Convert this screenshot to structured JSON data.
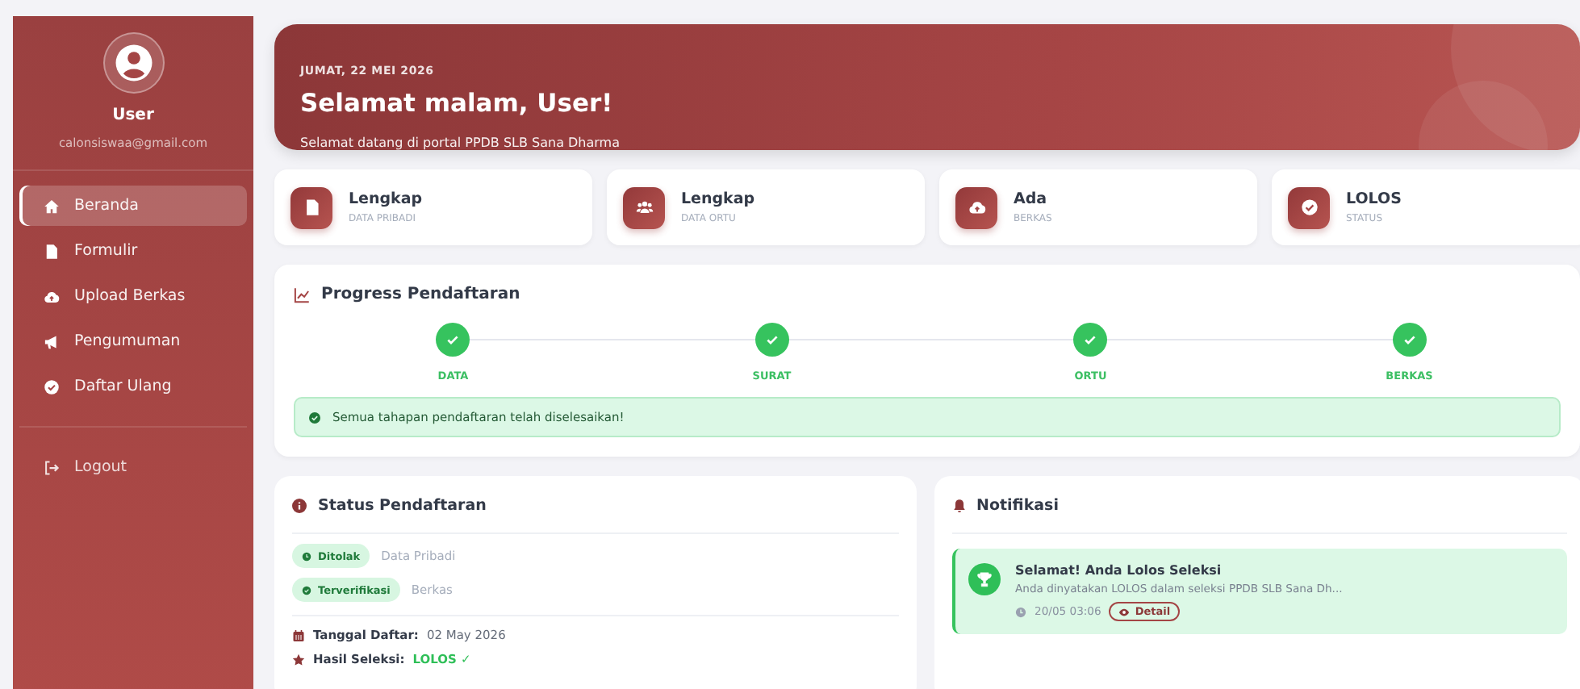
{
  "sidebar": {
    "user": {
      "name": "User",
      "email": "calonsiswaa@gmail.com"
    },
    "nav": [
      {
        "label": "Beranda",
        "selected": true
      },
      {
        "label": "Formulir",
        "selected": false
      },
      {
        "label": "Upload Berkas",
        "selected": false
      },
      {
        "label": "Pengumuman",
        "selected": false
      },
      {
        "label": "Daftar Ulang",
        "selected": false
      }
    ],
    "logout": {
      "label": "Logout"
    }
  },
  "hero": {
    "date": "JUMAT, 22 MEI 2026",
    "title": "Selamat malam, User!",
    "subtitle": "Selamat datang di portal PPDB SLB Sana Dharma"
  },
  "stats": [
    {
      "value": "Lengkap",
      "label": "DATA PRIBADI"
    },
    {
      "value": "Lengkap",
      "label": "DATA ORTU"
    },
    {
      "value": "Ada",
      "label": "BERKAS"
    },
    {
      "value": "LOLOS",
      "label": "STATUS"
    }
  ],
  "progress": {
    "title": "Progress Pendaftaran",
    "steps": [
      {
        "label": "DATA",
        "done": true
      },
      {
        "label": "SURAT",
        "done": true
      },
      {
        "label": "ORTU",
        "done": true
      },
      {
        "label": "BERKAS",
        "done": true
      }
    ],
    "message": "Semua tahapan pendaftaran telah diselesaikan!"
  },
  "status": {
    "title": "Status Pendaftaran",
    "badges": [
      {
        "badge": "Ditolak",
        "text": "Data Pribadi"
      },
      {
        "badge": "Terverifikasi",
        "text": "Berkas"
      }
    ],
    "details": [
      {
        "label": "Tanggal Daftar:",
        "value": "02 May 2026",
        "kind": "plain"
      },
      {
        "label": "Hasil Seleksi:",
        "value": "LOLOS ✓",
        "kind": "success"
      }
    ]
  },
  "notifications": {
    "title": "Notifikasi",
    "items": [
      {
        "title": "Selamat! Anda Lolos Seleksi",
        "body": "Anda dinyatakan LOLOS dalam seleksi PPDB SLB Sana Dh...",
        "time": "20/05 03:06",
        "action": "Detail"
      }
    ]
  }
}
